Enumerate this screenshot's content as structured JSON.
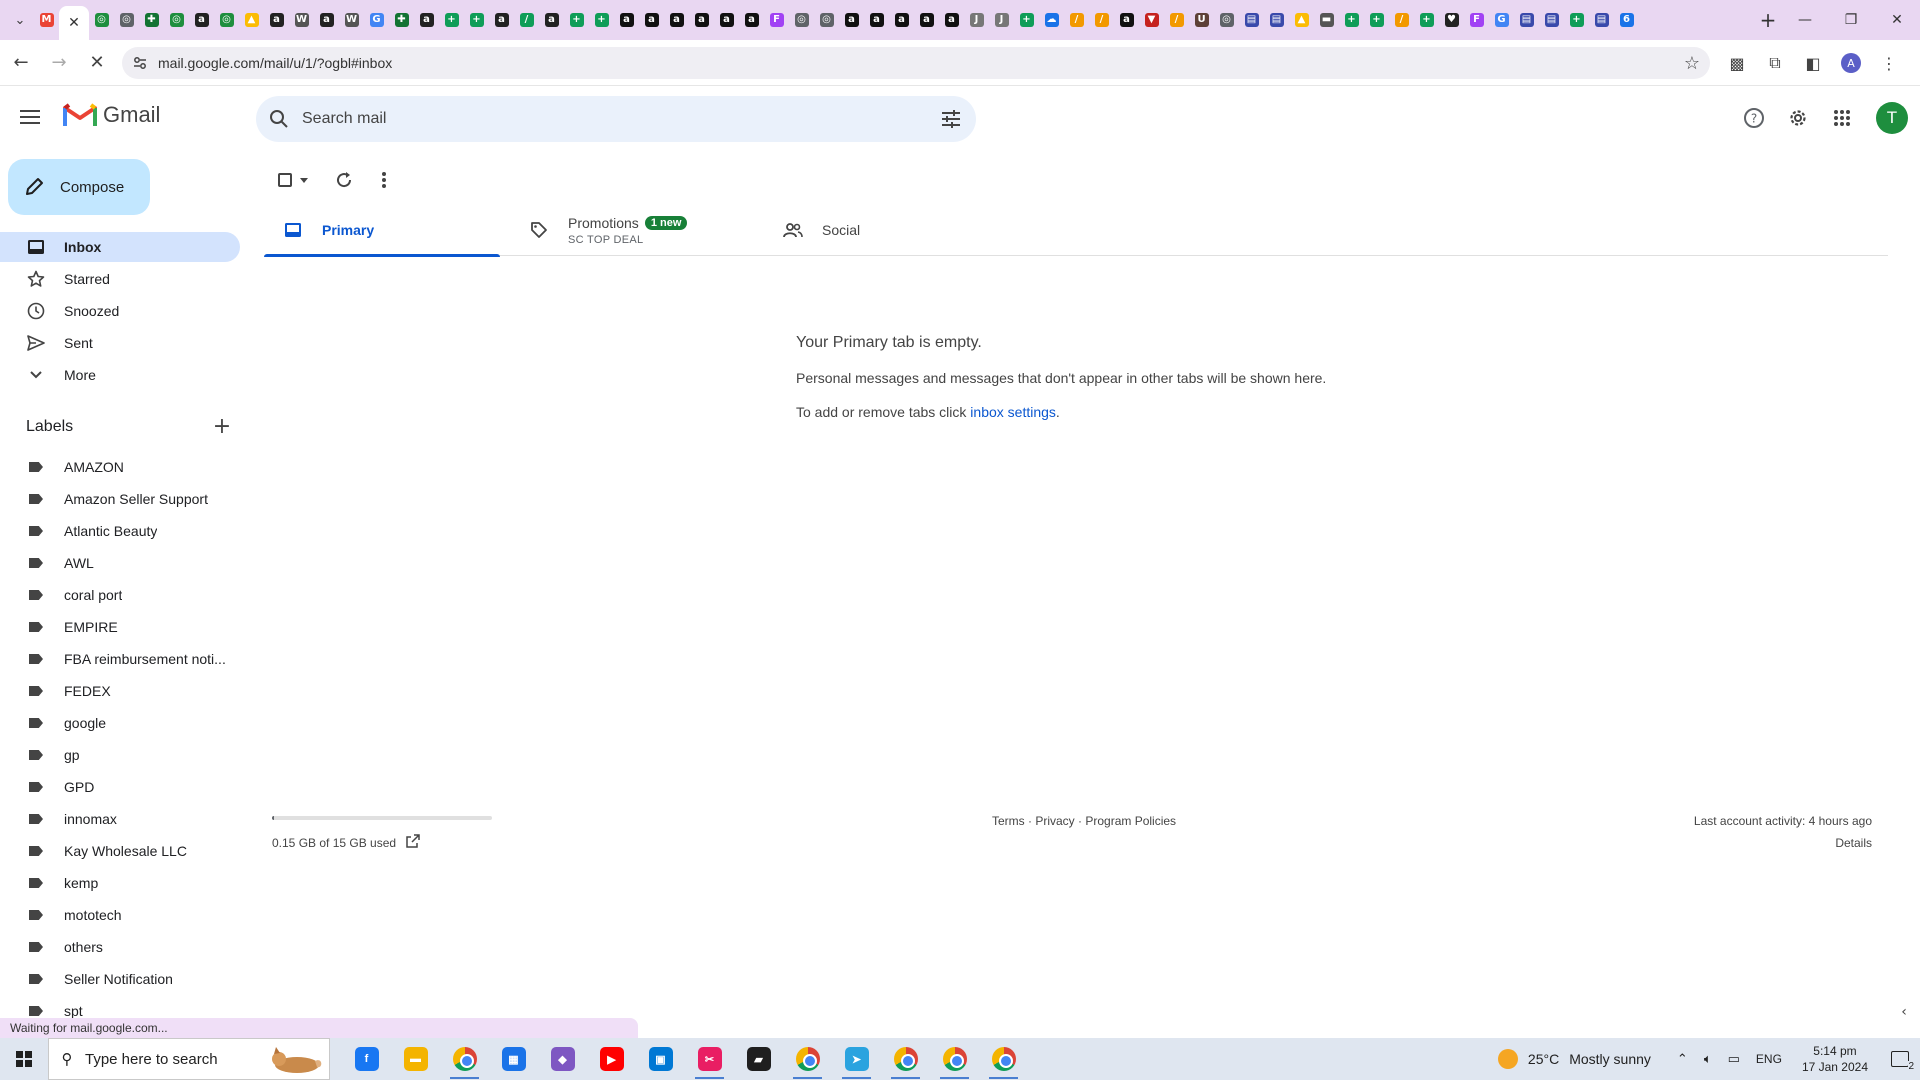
{
  "browser": {
    "tab_favicons": [
      {
        "glyph": "M",
        "color": "#ea4335"
      },
      {
        "glyph": "◎",
        "color": "#1e8e3e"
      },
      {
        "glyph": "◎",
        "color": "#1e8e3e"
      },
      {
        "glyph": "◎",
        "color": "#5f6368"
      },
      {
        "glyph": "✚",
        "color": "#137333"
      },
      {
        "glyph": "◎",
        "color": "#1e8e3e"
      },
      {
        "glyph": "a",
        "color": "#222222"
      },
      {
        "glyph": "◎",
        "color": "#1e8e3e"
      },
      {
        "glyph": "▲",
        "color": "#fbbc04"
      },
      {
        "glyph": "a",
        "color": "#222222"
      },
      {
        "glyph": "W",
        "color": "#555555"
      },
      {
        "glyph": "a",
        "color": "#222222"
      },
      {
        "glyph": "W",
        "color": "#555555"
      },
      {
        "glyph": "G",
        "color": "#4285f4"
      },
      {
        "glyph": "✚",
        "color": "#137333"
      },
      {
        "glyph": "a",
        "color": "#222222"
      },
      {
        "glyph": "+",
        "color": "#0f9d58"
      },
      {
        "glyph": "+",
        "color": "#0f9d58"
      },
      {
        "glyph": "a",
        "color": "#222222"
      },
      {
        "glyph": "/",
        "color": "#0f9d58"
      },
      {
        "glyph": "a",
        "color": "#222222"
      },
      {
        "glyph": "+",
        "color": "#0f9d58"
      },
      {
        "glyph": "+",
        "color": "#0f9d58"
      },
      {
        "glyph": "a",
        "color": "#111111"
      },
      {
        "glyph": "a",
        "color": "#111111"
      },
      {
        "glyph": "a",
        "color": "#111111"
      },
      {
        "glyph": "a",
        "color": "#111111"
      },
      {
        "glyph": "a",
        "color": "#111111"
      },
      {
        "glyph": "a",
        "color": "#111111"
      },
      {
        "glyph": "F",
        "color": "#a142f4"
      },
      {
        "glyph": "◎",
        "color": "#5f6368"
      },
      {
        "glyph": "◎",
        "color": "#5f6368"
      },
      {
        "glyph": "a",
        "color": "#111111"
      },
      {
        "glyph": "a",
        "color": "#111111"
      },
      {
        "glyph": "a",
        "color": "#111111"
      },
      {
        "glyph": "a",
        "color": "#111111"
      },
      {
        "glyph": "a",
        "color": "#111111"
      },
      {
        "glyph": "J",
        "color": "#777777"
      },
      {
        "glyph": "J",
        "color": "#777777"
      },
      {
        "glyph": "+",
        "color": "#0f9d58"
      },
      {
        "glyph": "☁",
        "color": "#1a73e8"
      },
      {
        "glyph": "/",
        "color": "#f29900"
      },
      {
        "glyph": "/",
        "color": "#f29900"
      },
      {
        "glyph": "a",
        "color": "#111111"
      },
      {
        "glyph": "▼",
        "color": "#c5221f"
      },
      {
        "glyph": "/",
        "color": "#f29900"
      },
      {
        "glyph": "U",
        "color": "#5d4037"
      },
      {
        "glyph": "◎",
        "color": "#5f6368"
      },
      {
        "glyph": "▤",
        "color": "#3949ab"
      },
      {
        "glyph": "▤",
        "color": "#3949ab"
      },
      {
        "glyph": "▲",
        "color": "#fbbc04"
      },
      {
        "glyph": "▬",
        "color": "#555555"
      },
      {
        "glyph": "+",
        "color": "#0f9d58"
      },
      {
        "glyph": "+",
        "color": "#0f9d58"
      },
      {
        "glyph": "/",
        "color": "#f29900"
      },
      {
        "glyph": "+",
        "color": "#0f9d58"
      },
      {
        "glyph": "♥",
        "color": "#222222"
      },
      {
        "glyph": "F",
        "color": "#a142f4"
      },
      {
        "glyph": "G",
        "color": "#4285f4"
      },
      {
        "glyph": "▤",
        "color": "#3949ab"
      },
      {
        "glyph": "▤",
        "color": "#3949ab"
      },
      {
        "glyph": "+",
        "color": "#0f9d58"
      },
      {
        "glyph": "▤",
        "color": "#3949ab"
      },
      {
        "glyph": "6",
        "color": "#1a73e8"
      }
    ],
    "active_tab_index": 1,
    "url": "mail.google.com/mail/u/1/?ogbl#inbox",
    "profile_initial": "A"
  },
  "gmail": {
    "product_name": "Gmail",
    "search_placeholder": "Search mail",
    "avatar_initial": "T",
    "compose_label": "Compose",
    "nav": [
      {
        "label": "Inbox",
        "icon": "inbox-icon",
        "selected": true
      },
      {
        "label": "Starred",
        "icon": "star-icon"
      },
      {
        "label": "Snoozed",
        "icon": "clock-icon"
      },
      {
        "label": "Sent",
        "icon": "send-icon"
      },
      {
        "label": "More",
        "icon": "chevron-down-icon"
      }
    ],
    "labels_heading": "Labels",
    "labels": [
      "AMAZON",
      "Amazon Seller Support",
      "Atlantic Beauty",
      "AWL",
      "coral port",
      "EMPIRE",
      "FBA reimbursement noti...",
      "FEDEX",
      "google",
      "gp",
      "GPD",
      "innomax",
      "Kay Wholesale LLC",
      "kemp",
      "mototech",
      "others",
      "Seller Notification",
      "spt"
    ],
    "tabs": {
      "primary": "Primary",
      "promotions": "Promotions",
      "promotions_badge": "1 new",
      "promotions_sub": "SC TOP DEAL",
      "social": "Social"
    },
    "empty_state": {
      "title": "Your Primary tab is empty.",
      "line1": "Personal messages and messages that don't appear in other tabs will be shown here.",
      "line2_prefix": "To add or remove tabs click ",
      "line2_link": "inbox settings",
      "line2_suffix": "."
    },
    "footer": {
      "storage": "0.15 GB of 15 GB used",
      "storage_fraction": 0.01,
      "terms": "Terms",
      "privacy": "Privacy",
      "program_policies": "Program Policies",
      "sep": " · ",
      "last_activity": "Last account activity: 4 hours ago",
      "details": "Details"
    }
  },
  "status_text": "Waiting for mail.google.com...",
  "taskbar": {
    "search_placeholder": "Type here to search",
    "apps": [
      {
        "name": "facebook",
        "glyph": "f",
        "color": "#1877f2"
      },
      {
        "name": "file-explorer",
        "glyph": "▬",
        "color": "#f4b400"
      },
      {
        "name": "chrome",
        "glyph": "",
        "color": "",
        "running": true
      },
      {
        "name": "calculator",
        "glyph": "▦",
        "color": "#1a73e8"
      },
      {
        "name": "copilot",
        "glyph": "◆",
        "color": "#7e57c2"
      },
      {
        "name": "youtube",
        "glyph": "▶",
        "color": "#ff0000"
      },
      {
        "name": "store",
        "glyph": "▣",
        "color": "#0078d4"
      },
      {
        "name": "snipping-tool",
        "glyph": "✂",
        "color": "#e91e63",
        "running": true
      },
      {
        "name": "sticky-notes",
        "glyph": "▰",
        "color": "#1f1f1f"
      },
      {
        "name": "chrome",
        "glyph": "",
        "color": "",
        "running": true
      },
      {
        "name": "telegram",
        "glyph": "➤",
        "color": "#2aa3df",
        "running": true
      },
      {
        "name": "chrome",
        "glyph": "",
        "color": "",
        "running": true
      },
      {
        "name": "chrome",
        "glyph": "",
        "color": "",
        "running": true
      },
      {
        "name": "chrome",
        "glyph": "",
        "color": "",
        "running": true
      }
    ],
    "weather_temp": "25°C",
    "weather_desc": "Mostly sunny",
    "language": "ENG",
    "time": "5:14 pm",
    "date": "17 Jan 2024",
    "notification_count": "2"
  }
}
